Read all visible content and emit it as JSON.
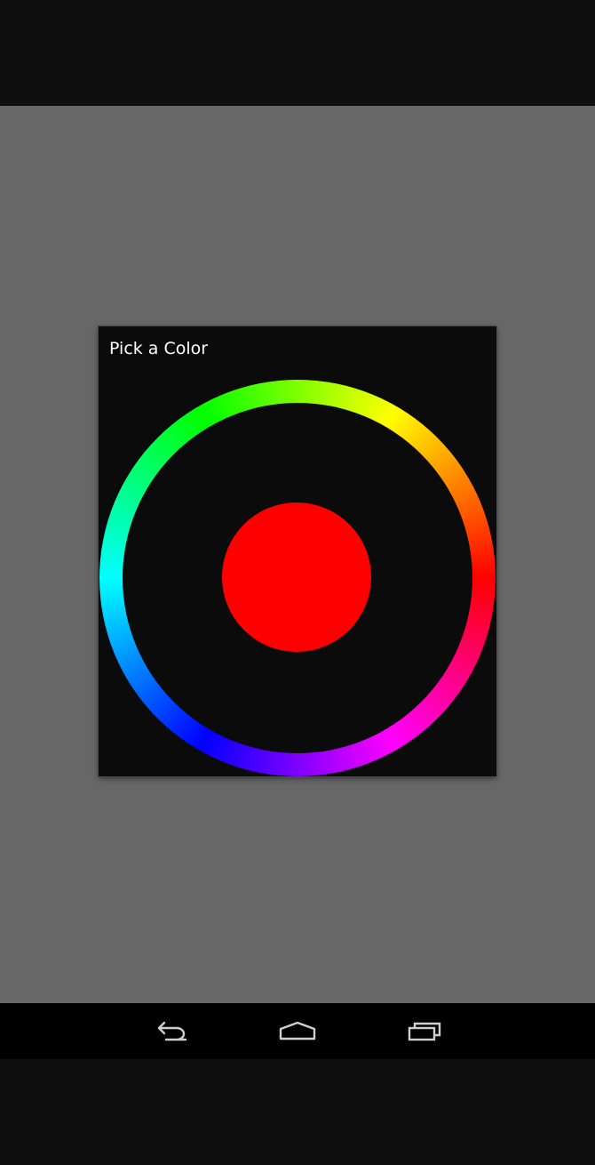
{
  "dialog": {
    "title": "Pick a Color"
  },
  "color_picker": {
    "selected_color": "#ff0000",
    "hue_ring_colors": [
      "#ff0000",
      "#ff00ff",
      "#0000ff",
      "#00ffff",
      "#00ff00",
      "#ffff00"
    ]
  },
  "navigation": {
    "icons": [
      "back-icon",
      "home-icon",
      "recent-apps-icon"
    ]
  },
  "colors": {
    "backdrop": "#676767",
    "dialog_background": "#0b0b0b",
    "status_bar": "#0f0f0f",
    "nav_bar": "#000000",
    "nav_icon": "#cfcfcf"
  }
}
